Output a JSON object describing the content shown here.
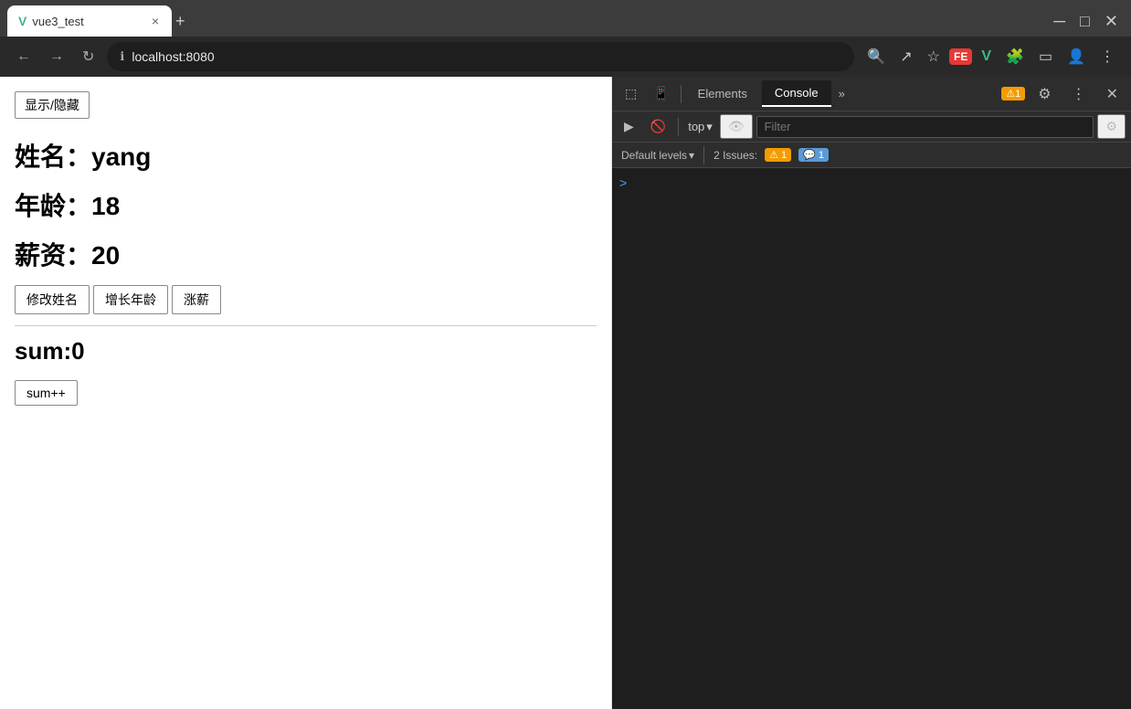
{
  "browser": {
    "tab": {
      "favicon": "V",
      "title": "vue3_test",
      "close": "×",
      "new_tab": "+"
    },
    "address": "localhost:8080",
    "nav": {
      "back": "←",
      "forward": "→",
      "reload": "↻"
    }
  },
  "page": {
    "show_hide_btn": "显示/隐藏",
    "name_label": "姓名：yang",
    "age_label": "年龄：18",
    "salary_label": "薪资：20",
    "btn_change_name": "修改姓名",
    "btn_increase_age": "增长年龄",
    "btn_raise_salary": "涨薪",
    "sum_display": "sum:0",
    "sum_btn": "sum++"
  },
  "devtools": {
    "tabs": {
      "elements": "Elements",
      "console": "Console"
    },
    "more": "»",
    "badge": "1",
    "gear": "⚙",
    "more_dots": "⋮",
    "close": "✕",
    "console_toolbar": {
      "play_icon": "▶",
      "block_icon": "🚫",
      "top_label": "top",
      "dropdown": "▾",
      "eye_icon": "👁",
      "filter_placeholder": "Filter",
      "gear_icon": "⚙"
    },
    "issues": {
      "label": "Default levels",
      "dropdown": "▾",
      "issues_text": "2 Issues:",
      "warn_count": "1",
      "info_count": "1"
    },
    "console_prompt": ">"
  }
}
